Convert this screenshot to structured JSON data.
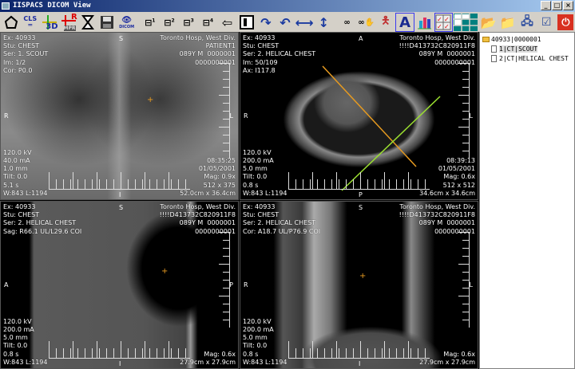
{
  "window": {
    "title": "IISPACS DICOM View",
    "min": "_",
    "max": "□",
    "close": "×"
  },
  "toolbar": {
    "cls_label": "CLS",
    "3d_label": "3D",
    "mpr_label": "MPR",
    "r_label": "R",
    "dicom_label": "DICOM",
    "text_label": "A",
    "layout_labels": [
      "1",
      "2",
      "3",
      "4"
    ]
  },
  "viewports": [
    {
      "name": "scout",
      "tl": [
        "Ex: 40933",
        "Stu: CHEST",
        "Ser: 1. SCOUT",
        "Im: 1/2",
        "Cor: P0.0"
      ],
      "tr": [
        "Toronto Hosp, West Div.",
        "PATIENT1",
        "089Y M  0000001",
        "0000000001"
      ],
      "bl": [
        "120.0 kV",
        "40.0 mA",
        "1.0 mm",
        "Tilt: 0.0",
        "5.1 s",
        "W:843 L:1194"
      ],
      "br": [
        "08:35:25",
        "01/05/2001",
        "Mag: 0.9x",
        "512 x 375",
        "52.0cm x 36.4cm"
      ],
      "ori": {
        "top": "S",
        "left": "R",
        "right": "L",
        "bottom": "I"
      }
    },
    {
      "name": "axial",
      "tl": [
        "Ex: 40933",
        "Stu: CHEST",
        "Ser: 2. HELICAL CHEST",
        "Im: 50/109",
        "Ax: I117.8"
      ],
      "tr": [
        "Toronto Hosp, West Div.",
        "!!!!D413732C820911F8",
        "089Y M  0000001",
        "0000000001"
      ],
      "bl": [
        "120.0 kV",
        "200.0 mA",
        "5.0 mm",
        "Tilt: 0.0",
        "0.8 s",
        "W:843 L:1194"
      ],
      "br": [
        "08:39:13",
        "01/05/2001",
        "Mag: 0.6x",
        "512 x 512",
        "34.6cm x 34.6cm"
      ],
      "ori": {
        "top": "A",
        "left": "R",
        "right": "L",
        "bottom": "P"
      }
    },
    {
      "name": "sagittal",
      "tl": [
        "Ex: 40933",
        "Stu: CHEST",
        "Ser: 2. HELICAL CHEST",
        "Sag: R66.1 UL/L29.6 COI"
      ],
      "tr": [
        "Toronto Hosp, West Div.",
        "!!!!D413732C820911F8",
        "089Y M  0000001",
        "0000000001"
      ],
      "bl": [
        "120.0 kV",
        "200.0 mA",
        "5.0 mm",
        "Tilt: 0.0",
        "0.8 s",
        "W:843 L:1194"
      ],
      "br": [
        "Mag: 0.6x",
        "27.9cm x 27.9cm"
      ],
      "ori": {
        "top": "S",
        "left": "A",
        "right": "P",
        "bottom": "I"
      }
    },
    {
      "name": "coronal",
      "tl": [
        "Ex: 40933",
        "Stu: CHEST",
        "Ser: 2. HELICAL CHEST",
        "Cor: A18.7 UL/P76.9 COI"
      ],
      "tr": [
        "Toronto Hosp, West Div.",
        "!!!!D413732C820911F8",
        "089Y M  0000001",
        "0000000001"
      ],
      "bl": [
        "120.0 kV",
        "200.0 mA",
        "5.0 mm",
        "Tilt: 0.0",
        "0.8 s",
        "W:843 L:1194"
      ],
      "br": [
        "Mag: 0.6x",
        "27.9cm x 27.9cm"
      ],
      "ori": {
        "top": "S",
        "left": "R",
        "right": "L",
        "bottom": "I"
      }
    }
  ],
  "tree": {
    "root": "40933|0000001",
    "items": [
      {
        "label": "1|CT|SCOUT",
        "selected": true
      },
      {
        "label": "2|CT|HELICAL CHEST",
        "selected": false
      }
    ]
  },
  "colors": {
    "crosshair": "#e69a20",
    "orange_line": "#e69a20",
    "green_line": "#9be030",
    "selection": "#3a3af0"
  }
}
